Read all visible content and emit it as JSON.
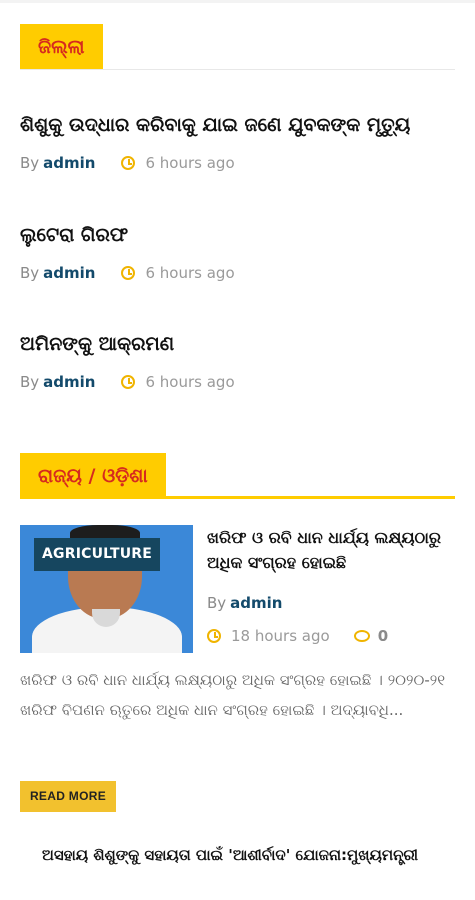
{
  "sections": [
    {
      "label": "ଜିଲ୍ଲା"
    },
    {
      "label": "ରାଜ୍ୟ / ଓଡ଼ିଶା"
    }
  ],
  "district_posts": [
    {
      "title": "ଶିଶୁକୁ ଉଦ୍ଧାର କରିବାକୁ ଯାଇ ଜଣେ ଯୁବକଙ୍କ ମୃତ୍ୟୁ",
      "by": "By",
      "author": "admin",
      "time": "6 hours ago"
    },
    {
      "title": "ଲୁଟେରା ଗିରଫ",
      "by": "By",
      "author": "admin",
      "time": "6 hours ago"
    },
    {
      "title": "ଅମିନଙ୍କୁ ଆକ୍ରମଣ",
      "by": "By",
      "author": "admin",
      "time": "6 hours ago"
    }
  ],
  "featured": {
    "category": "AGRICULTURE",
    "title": "ଖରିଫ ଓ ରବି ଧାନ ଧାର୍ଯ୍ୟ ଲକ୍ଷ୍ୟଠାରୁ ଅଧିକ ସଂଗ୍ରହ ହୋଇଛି",
    "by": "By",
    "author": "admin",
    "time": "18 hours ago",
    "comments": "0",
    "excerpt": "ଖରିଫ ଓ ରବି ଧାନ ଧାର୍ଯ୍ୟ ଲକ୍ଷ୍ୟଠାରୁ ଅଧିକ ସଂଗ୍ରହ ହୋଇଛି । ୨୦୨୦-୨୧ ଖରିଫ ବିପଣନ ଋତୁରେ ଅଧିକ ଧାନ ସଂଗ୍ରହ ହୋଇଛି । ଅଦ୍ୟାବଧି...",
    "read_more": "READ MORE"
  },
  "next_post": {
    "title": "ଅସହାୟ ଶିଶୁଙ୍କୁ ସହାୟତା ପାଇଁ 'ଆଶୀର୍ବାଦ' ଯୋଜନା:ମୁଖ୍ୟମନ୍ତ୍ରୀ"
  },
  "colors": {
    "accent": "#ffcc00",
    "section_text": "#d62a1e",
    "author": "#134a6b",
    "clock": "#f0b400",
    "badge": "#16465f"
  },
  "icons": {
    "time": "clock-icon",
    "comments": "comment-icon"
  }
}
